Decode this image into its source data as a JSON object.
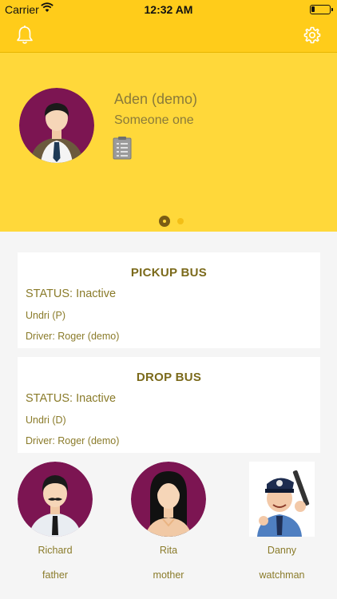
{
  "status_bar": {
    "carrier": "Carrier",
    "time": "12:32 AM",
    "battery_level": 0.2
  },
  "nav": {
    "left_icon": "bell-icon",
    "right_icon": "gear-icon"
  },
  "profile": {
    "name": "Aden (demo)",
    "subtitle": "Someone one",
    "avatar_icon": "student-avatar-icon",
    "detail_icon": "clipboard-icon"
  },
  "pager": {
    "pages": 2,
    "active": 0
  },
  "pickup_bus": {
    "title": "PICKUP BUS",
    "status": "STATUS: Inactive",
    "route": "Undri (P)",
    "driver": "Driver: Roger (demo)"
  },
  "drop_bus": {
    "title": "DROP BUS",
    "status": "STATUS: Inactive",
    "route": "Undri (D)",
    "driver": "Driver: Roger (demo)"
  },
  "contacts": [
    {
      "name": "Richard",
      "role": "father",
      "icon": "father-avatar-icon"
    },
    {
      "name": "Rita",
      "role": "mother",
      "icon": "mother-avatar-icon"
    },
    {
      "name": "Danny",
      "role": "watchman",
      "icon": "watchman-avatar-icon"
    }
  ],
  "colors": {
    "header": "#ffcc1a",
    "hero": "#ffd83a",
    "text_accent": "#8a7a3a",
    "avatar_bg": "#7c1552"
  }
}
